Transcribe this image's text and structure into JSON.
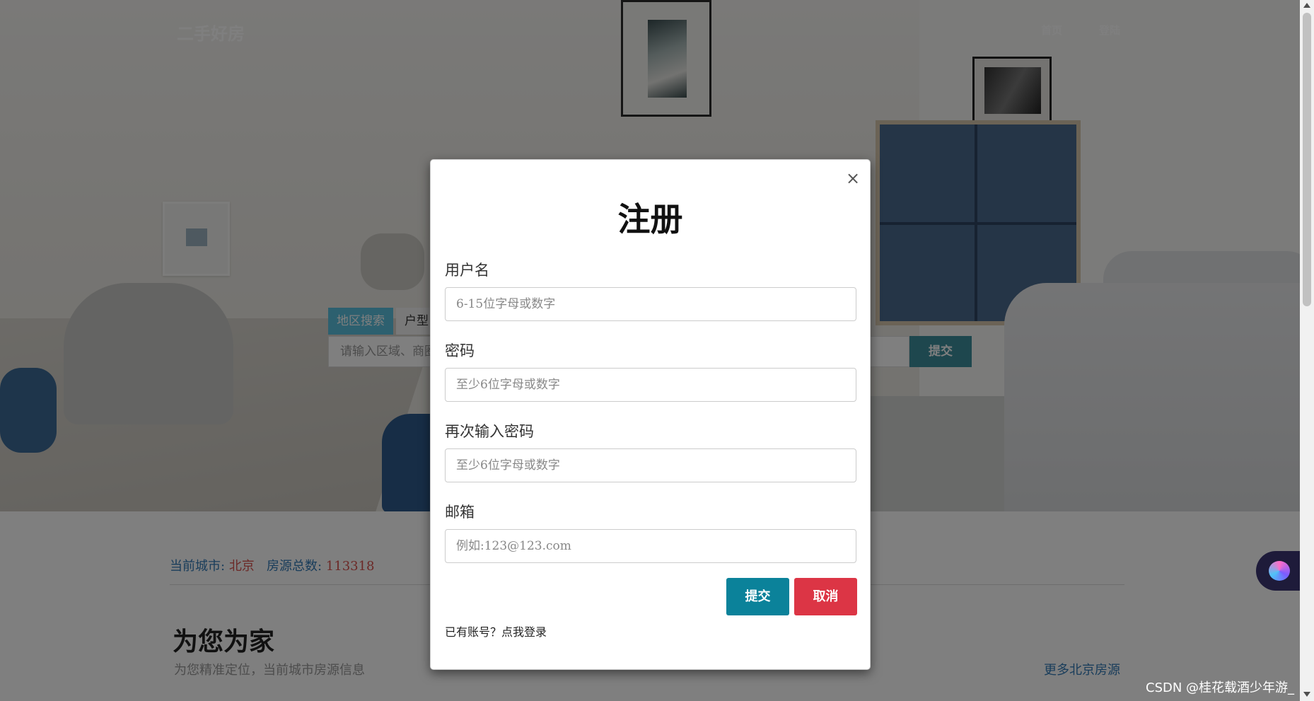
{
  "header": {
    "logo": "二手好房",
    "nav": [
      {
        "label": "首页"
      },
      {
        "label": "登陆"
      }
    ]
  },
  "search": {
    "tabs": [
      {
        "label": "地区搜索",
        "active": true
      },
      {
        "label": "户型",
        "active": false
      }
    ],
    "placeholder": "请输入区域、商圈",
    "submit_label": "提交"
  },
  "stats": {
    "city_label": "当前城市:",
    "city": "北京",
    "count_label": "房源总数:",
    "count": "113318"
  },
  "section": {
    "title": "为您为家",
    "subtitle": "为您精准定位，当前城市房源信息",
    "more_link": "更多北京房源"
  },
  "modal": {
    "title": "注册",
    "close_glyph": "×",
    "fields": [
      {
        "label": "用户名",
        "placeholder": "6-15位字母或数字"
      },
      {
        "label": "密码",
        "placeholder": "至少6位字母或数字"
      },
      {
        "label": "再次输入密码",
        "placeholder": "至少6位字母或数字"
      },
      {
        "label": "邮箱",
        "placeholder": "例如:123@123.com"
      }
    ],
    "submit_label": "提交",
    "cancel_label": "取消",
    "login_prompt": "已有账号？点我登录"
  },
  "watermark": "CSDN @桂花载酒少年游_",
  "colors": {
    "submit": "#0b829a",
    "cancel": "#dc3545",
    "tab_active": "#5bc0de",
    "link": "#337ab7",
    "highlight": "#d9534f"
  },
  "icons": {
    "close": "close-icon",
    "assistant": "ai-assistant-icon"
  }
}
